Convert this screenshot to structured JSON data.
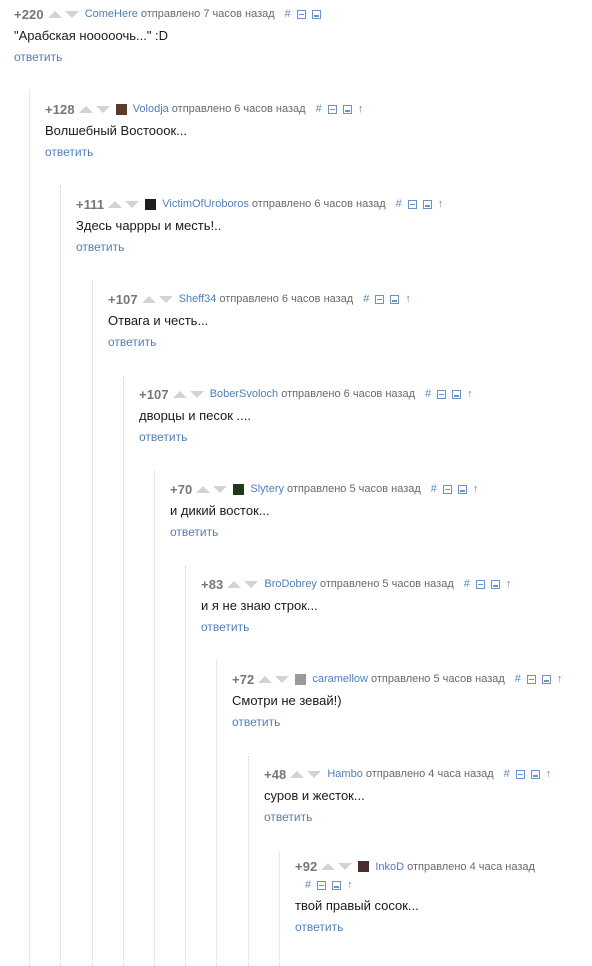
{
  "reply_label": "ответить",
  "comments": [
    {
      "rating": "+220",
      "author": "ComeHere",
      "time": "отправлено 7 часов назад",
      "text": "\"Арабская нооооочь...\" :D",
      "has_avatar": false,
      "has_parent_link": false
    },
    {
      "rating": "+128",
      "author": "Volodja",
      "time": "отправлено 6 часов назад",
      "text": "Волшебный Востооок...",
      "has_avatar": true,
      "avatar_color": "#5a3b2a",
      "has_parent_link": true
    },
    {
      "rating": "+111",
      "author": "VictimOfUroboros",
      "time": "отправлено 6 часов назад",
      "text": "Здесь чаррры и месть!..",
      "has_avatar": true,
      "avatar_color": "#1e1e1e",
      "has_parent_link": true
    },
    {
      "rating": "+107",
      "author": "Sheff34",
      "time": "отправлено 6 часов назад",
      "text": "Отвага и честь...",
      "has_avatar": false,
      "has_parent_link": true
    },
    {
      "rating": "+107",
      "author": "BoberSvoloch",
      "time": "отправлено 6 часов назад",
      "text": "дворцы и песок ....",
      "has_avatar": false,
      "has_parent_link": true
    },
    {
      "rating": "+70",
      "author": "Slytery",
      "time": "отправлено 5 часов назад",
      "text": "и дикий восток...",
      "has_avatar": true,
      "avatar_color": "#1f3a16",
      "has_parent_link": true
    },
    {
      "rating": "+83",
      "author": "BroDobrey",
      "time": "отправлено 5 часов назад",
      "text": "и я не знаю строк...",
      "has_avatar": false,
      "has_parent_link": true
    },
    {
      "rating": "+72",
      "author": "caramellow",
      "time": "отправлено 5 часов назад",
      "text": "Смотри не зевай!)",
      "has_avatar": true,
      "avatar_color": "#9a9a9a",
      "has_parent_link": true
    },
    {
      "rating": "+48",
      "author": "Hambo",
      "time": "отправлено 4 часа назад",
      "text": "суров и жесток...",
      "has_avatar": false,
      "has_parent_link": true
    },
    {
      "rating": "+92",
      "author": "InkoD",
      "time": "отправлено 4 часа назад",
      "text": "твой правый сосок...",
      "has_avatar": true,
      "avatar_color": "#4a2e30",
      "has_parent_link": true
    }
  ],
  "icons": {
    "upvote": "triangle-up-icon",
    "downvote": "triangle-down-icon",
    "permalink": "hash-icon",
    "collapse": "minus-box-icon",
    "save": "floppy-icon",
    "parent": "arrow-up-icon"
  },
  "colors": {
    "author": "#4f7fb8",
    "reply": "#4f7fb8",
    "text": "#1a1a1a",
    "meta": "#6a6a6a",
    "vote": "#d3d3d3",
    "thread_line": "#d4d4d4"
  }
}
